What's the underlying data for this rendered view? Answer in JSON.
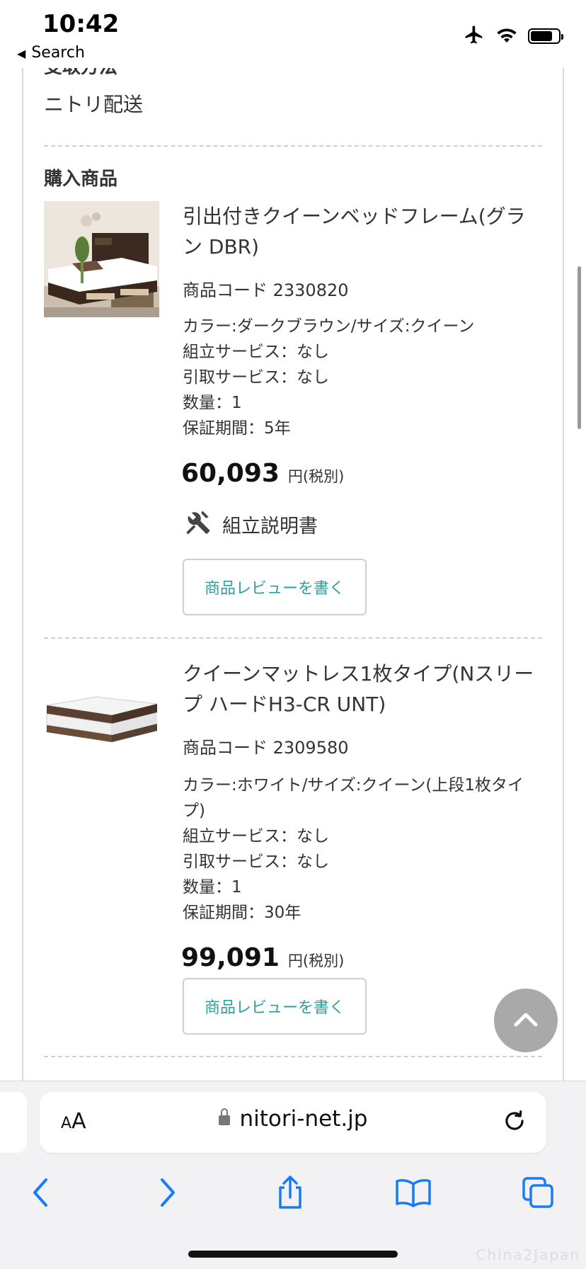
{
  "status_bar": {
    "time": "10:42",
    "back_label": "Search"
  },
  "delivery": {
    "method_label_partial": "受取方法",
    "method_value": "ニトリ配送"
  },
  "purchased": {
    "title": "購入商品",
    "items": [
      {
        "name": "引出付きクイーンベッドフレーム(グラン DBR)",
        "code": "商品コード 2330820",
        "attrs": [
          "カラー:ダークブラウン/サイズ:クイーン",
          "組立サービス：なし",
          "引取サービス：なし",
          "数量：1",
          "保証期間：5年"
        ],
        "price": "60,093",
        "price_unit": "円(税別)",
        "manual_label": "組立説明書",
        "review_label": "商品レビューを書く"
      },
      {
        "name": "クイーンマットレス1枚タイプ(Nスリープ ハードH3-CR UNT)",
        "code": "商品コード 2309580",
        "attrs": [
          "カラー:ホワイト/サイズ:クイーン(上段1枚タイプ)",
          "組立サービス：なし",
          "引取サービス：なし",
          "数量：1",
          "保証期間：30年"
        ],
        "price": "99,091",
        "price_unit": "円(税別)",
        "review_label": "商品レビューを書く"
      }
    ]
  },
  "browser": {
    "text_size_label": "AA",
    "url": "nitori-net.jp"
  },
  "watermark": "China2Japan",
  "icons": {
    "airplane": "airplane-icon",
    "wifi": "wifi-icon",
    "battery": "battery-icon",
    "tools": "tools-icon",
    "scroll_top": "chevron-up-icon",
    "lock": "lock-icon",
    "reload": "reload-icon",
    "back": "chevron-left-icon",
    "forward": "chevron-right-icon",
    "share": "share-icon",
    "bookmarks": "book-icon",
    "tabs": "tabs-icon"
  },
  "colors": {
    "accent": "#2fa09c",
    "scroll_top_bg": "#a9a9a9"
  }
}
